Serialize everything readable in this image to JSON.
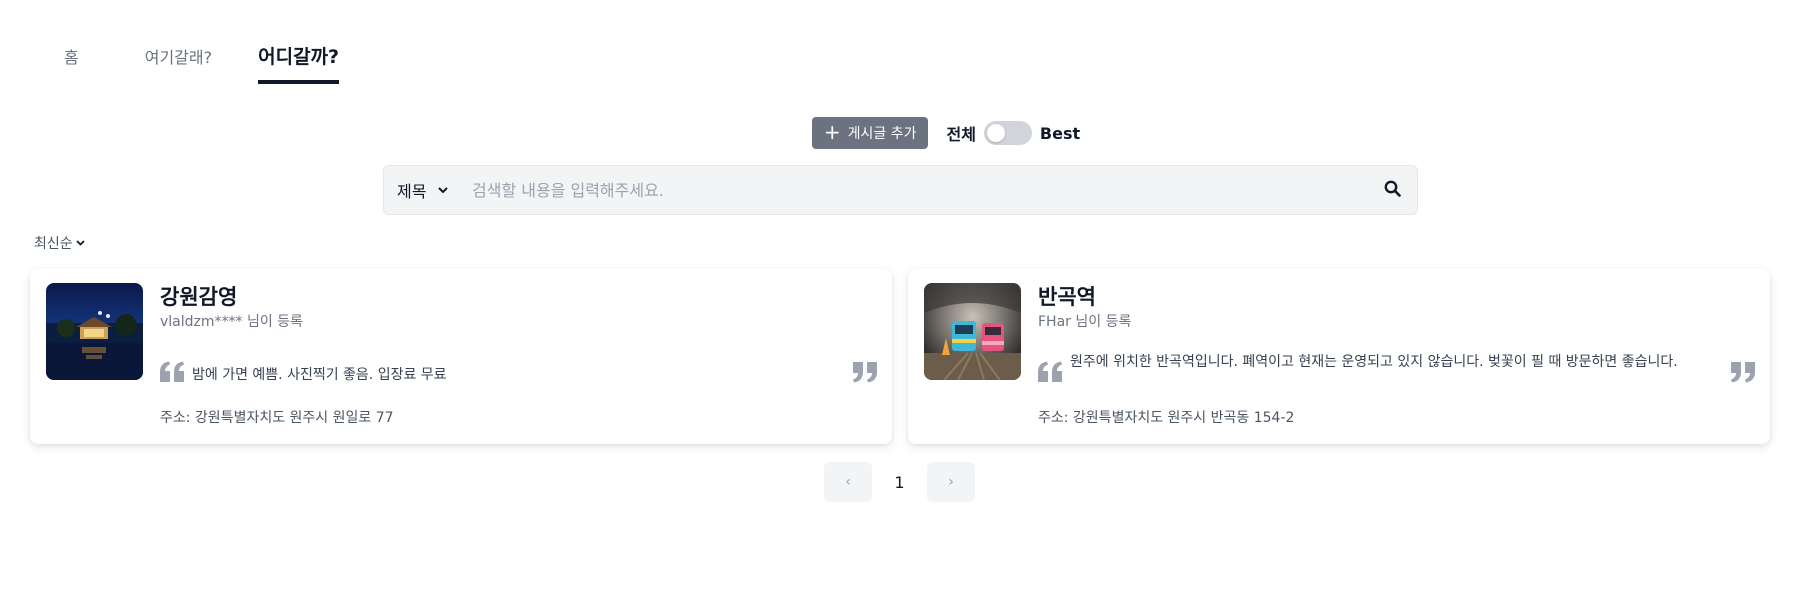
{
  "tabs": [
    {
      "label": "홈"
    },
    {
      "label": "여기갈래?"
    },
    {
      "label": "어디갈까?",
      "active": true
    }
  ],
  "toolbar": {
    "add_label": "게시글 추가",
    "toggle_left": "전체",
    "toggle_right": "Best",
    "toggle_on": false
  },
  "search": {
    "field_selected": "제목",
    "placeholder": "검색할 내용을 입력해주세요.",
    "value": ""
  },
  "sort": {
    "label": "최신순"
  },
  "cards": [
    {
      "title": "강원감영",
      "author": "vlaldzm**** 님이 등록",
      "description": "밤에 가면 예쁨. 사진찍기 좋음. 입장료 무료",
      "address": "주소: 강원특별자치도 원주시 원일로 77"
    },
    {
      "title": "반곡역",
      "author": "FHar 님이 등록",
      "description": "원주에 위치한 반곡역입니다. 폐역이고 현재는 운영되고 있지 않습니다. 벚꽃이 필 때 방문하면 좋습니다.",
      "address": "주소: 강원특별자치도 원주시 반곡동 154-2"
    }
  ],
  "pagination": {
    "current": "1",
    "prev_icon": "‹",
    "next_icon": "›"
  },
  "colors": {
    "accent": "#111827",
    "button_gray": "#6b7280",
    "quote_gray": "#9ca3af"
  }
}
